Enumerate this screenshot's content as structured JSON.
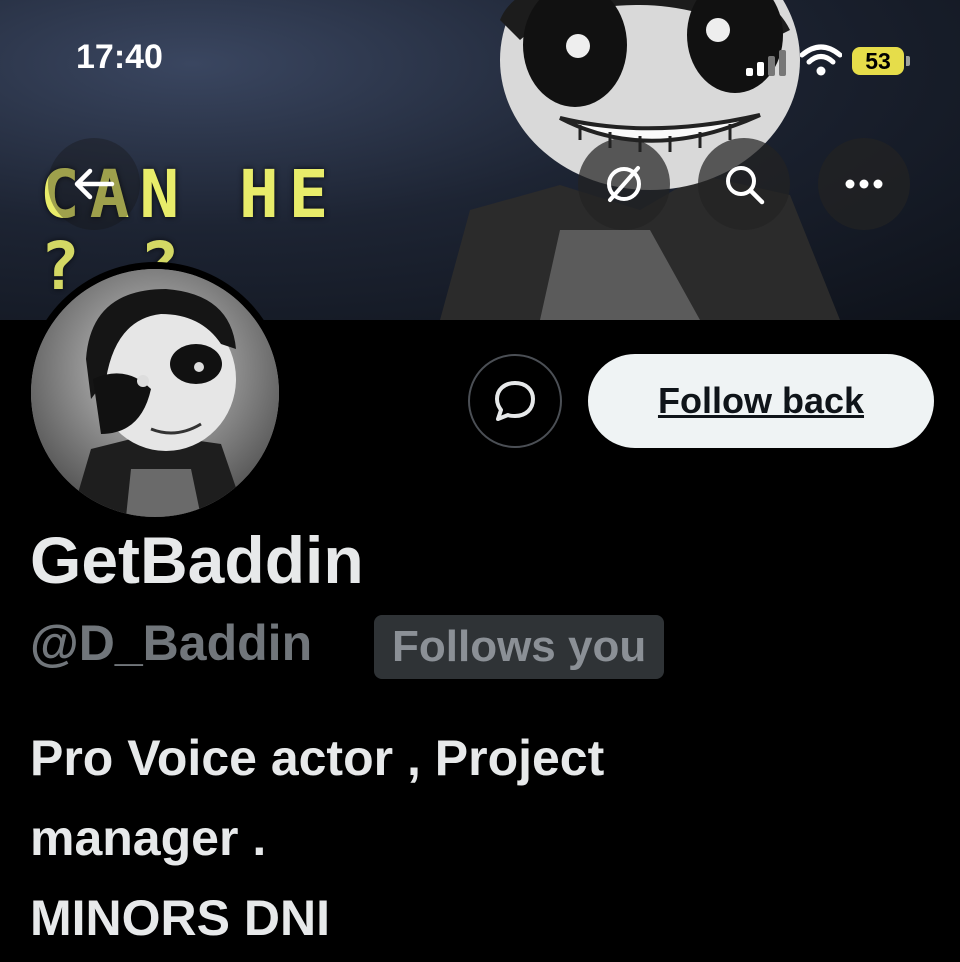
{
  "status_bar": {
    "time": "17:40",
    "battery": "53"
  },
  "banner": {
    "line1": "CAN HE",
    "line2": "? ?"
  },
  "actions": {
    "follow_label": "Follow back"
  },
  "profile": {
    "display_name": "GetBaddin",
    "handle": "@D_Baddin",
    "follows_you": "Follows you",
    "bio_lines": [
      "Pro Voice actor , Project",
      "manager .",
      "MINORS DNI"
    ]
  },
  "colors": {
    "background": "#000000",
    "follow_button": "#eff3f4",
    "battery": "#e6dd4a",
    "banner_text": "#e8ec6a"
  }
}
